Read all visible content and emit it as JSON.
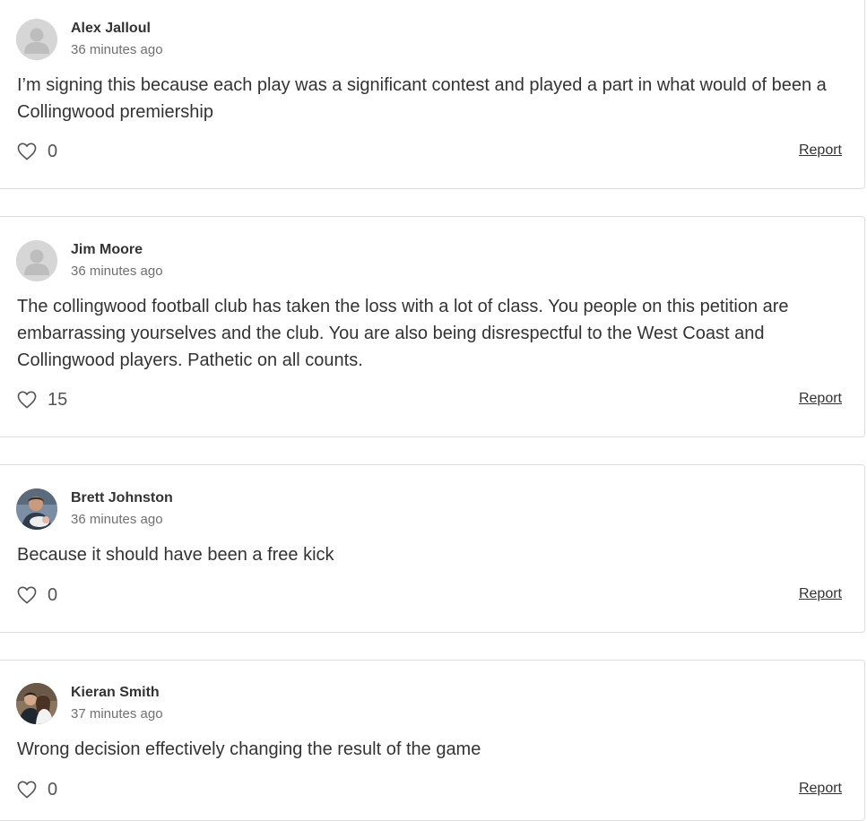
{
  "colors": {
    "card_border": "#dedede",
    "text": "#333333",
    "muted_text": "#707070",
    "avatar_placeholder": "#d6d6d6"
  },
  "comments": [
    {
      "author": "Alex Jalloul",
      "time": "36 minutes ago",
      "text": "I’m signing this because each play was a significant contest and played a part in what would of been a Collingwood premiership",
      "likes": "0",
      "report_label": "Report",
      "avatar": "default-avatar-icon"
    },
    {
      "author": "Jim Moore",
      "time": "36 minutes ago",
      "text": "The collingwood football club has taken the loss with a lot of class. You people on this petition are embarrassing yourselves and the club. You are also being disrespectful to the West Coast and Collingwood players. Pathetic on all counts.",
      "likes": "15",
      "report_label": "Report",
      "avatar": "default-avatar-icon"
    },
    {
      "author": "Brett Johnston",
      "time": "36 minutes ago",
      "text": "Because it should have been a free kick",
      "likes": "0",
      "report_label": "Report",
      "avatar": "user-photo"
    },
    {
      "author": "Kieran Smith",
      "time": "37 minutes ago",
      "text": "Wrong decision effectively changing the result of the game",
      "likes": "0",
      "report_label": "Report",
      "avatar": "user-photo"
    }
  ]
}
